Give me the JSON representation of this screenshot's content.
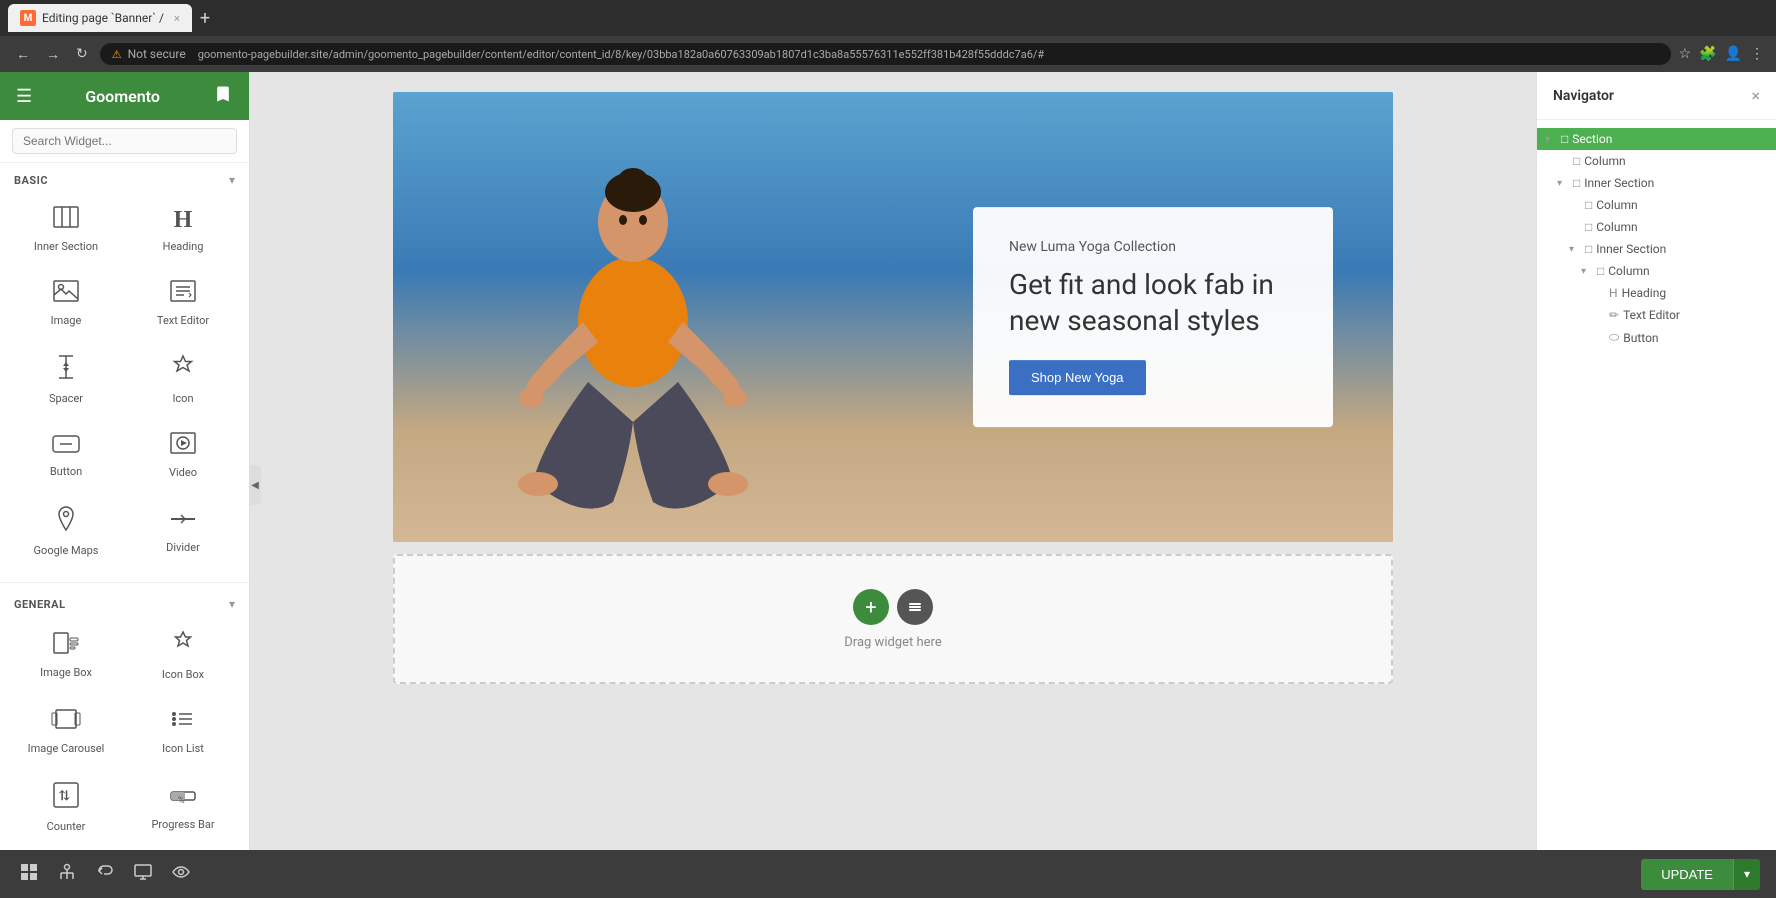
{
  "browser": {
    "tab_title": "Editing page `Banner` /",
    "tab_favicon": "M",
    "address": "goomento-pagebuilder.site/admin/goomento_pagebuilder/content/editor/content_id/8/key/03bba182a0a60763309ab1807d1c3ba8a55576311e552ff381b428f55dddc7a6/#",
    "security_label": "Not secure"
  },
  "sidebar": {
    "logo": "Goomento",
    "search_placeholder": "Search Widget...",
    "sections": [
      {
        "label": "BASIC",
        "widgets": [
          {
            "icon": "⊞",
            "label": "Inner Section"
          },
          {
            "icon": "H",
            "label": "Heading"
          },
          {
            "icon": "🖼",
            "label": "Image"
          },
          {
            "icon": "✏",
            "label": "Text Editor"
          },
          {
            "icon": "↕",
            "label": "Spacer"
          },
          {
            "icon": "❖",
            "label": "Icon"
          },
          {
            "icon": "⬭",
            "label": "Button"
          },
          {
            "icon": "▶",
            "label": "Video"
          },
          {
            "icon": "📍",
            "label": "Google Maps"
          },
          {
            "icon": "⇌",
            "label": "Divider"
          }
        ]
      },
      {
        "label": "GENERAL",
        "widgets": [
          {
            "icon": "🖼",
            "label": "Image Box"
          },
          {
            "icon": "★",
            "label": "Icon Box"
          },
          {
            "icon": "🎠",
            "label": "Image Carousel"
          },
          {
            "icon": "≡",
            "label": "Icon List"
          },
          {
            "icon": "⓵",
            "label": "Counter"
          },
          {
            "icon": "%",
            "label": "Progress Bar"
          }
        ]
      }
    ]
  },
  "canvas": {
    "hero": {
      "subtitle": "New Luma Yoga Collection",
      "title": "Get fit and look fab in new seasonal styles",
      "button_label": "Shop New Yoga"
    },
    "drop_zone": {
      "text": "Drag widget here"
    }
  },
  "navigator": {
    "title": "Navigator",
    "tree": [
      {
        "label": "Section",
        "level": 0,
        "active": true,
        "has_toggle": true,
        "expanded": true,
        "icon": "□"
      },
      {
        "label": "Column",
        "level": 1,
        "active": false,
        "has_toggle": false,
        "expanded": false,
        "icon": "□"
      },
      {
        "label": "Inner Section",
        "level": 1,
        "active": false,
        "has_toggle": true,
        "expanded": true,
        "icon": "□"
      },
      {
        "label": "Column",
        "level": 2,
        "active": false,
        "has_toggle": false,
        "expanded": false,
        "icon": "□"
      },
      {
        "label": "Column",
        "level": 2,
        "active": false,
        "has_toggle": false,
        "expanded": false,
        "icon": "□"
      },
      {
        "label": "Inner Section",
        "level": 2,
        "active": false,
        "has_toggle": true,
        "expanded": true,
        "icon": "□"
      },
      {
        "label": "Column",
        "level": 3,
        "active": false,
        "has_toggle": true,
        "expanded": true,
        "icon": "□"
      },
      {
        "label": "Heading",
        "level": 4,
        "active": false,
        "has_toggle": false,
        "expanded": false,
        "icon": "H"
      },
      {
        "label": "Text Editor",
        "level": 4,
        "active": false,
        "has_toggle": false,
        "expanded": false,
        "icon": "✏"
      },
      {
        "label": "Button",
        "level": 4,
        "active": false,
        "has_toggle": false,
        "expanded": false,
        "icon": "⬭"
      }
    ]
  },
  "toolbar": {
    "update_label": "UPDATE"
  },
  "icons": {
    "hamburger": "☰",
    "bookmark": "🔖",
    "back": "←",
    "forward": "→",
    "reload": "↻",
    "lock": "⚠",
    "star": "☆",
    "extension": "🧩",
    "account": "👤",
    "menu_dots": "⋮",
    "close": "×",
    "arrow_down": "▾",
    "add": "+",
    "handle": "⠿",
    "collapse_left": "◀"
  }
}
